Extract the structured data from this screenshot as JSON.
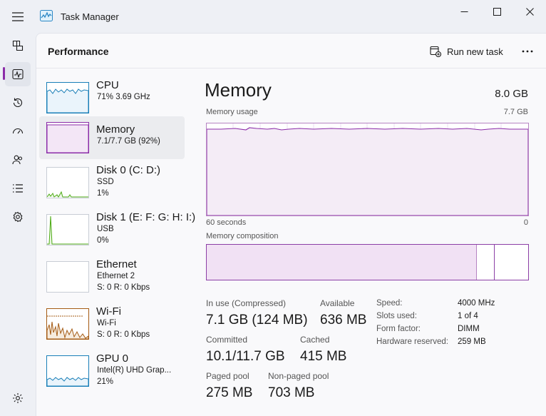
{
  "window": {
    "title": "Task Manager",
    "controls": [
      "minimize",
      "maximize",
      "close"
    ]
  },
  "nav": {
    "items": [
      {
        "name": "processes",
        "icon": "processes-icon"
      },
      {
        "name": "performance",
        "icon": "performance-icon",
        "active": true
      },
      {
        "name": "app-history",
        "icon": "history-icon"
      },
      {
        "name": "startup-apps",
        "icon": "startup-icon"
      },
      {
        "name": "users",
        "icon": "users-icon"
      },
      {
        "name": "details",
        "icon": "details-icon"
      },
      {
        "name": "services",
        "icon": "services-icon"
      },
      {
        "name": "settings",
        "icon": "gear-icon"
      }
    ]
  },
  "header": {
    "title": "Performance",
    "run_new_task": "Run new task"
  },
  "perf_list": [
    {
      "title": "CPU",
      "lines": [
        "71%  3.69 GHz"
      ],
      "color": "#1a7fb8"
    },
    {
      "title": "Memory",
      "lines": [
        "7.1/7.7 GB (92%)"
      ],
      "color": "#8b2ca8",
      "selected": true
    },
    {
      "title": "Disk 0 (C: D:)",
      "lines": [
        "SSD",
        "1%"
      ],
      "color": "#4caa14"
    },
    {
      "title": "Disk 1 (E: F: G: H: I:)",
      "lines": [
        "USB",
        "0%"
      ],
      "color": "#4caa14"
    },
    {
      "title": "Ethernet",
      "lines": [
        "Ethernet 2",
        "S: 0  R: 0 Kbps"
      ],
      "color": "#a55b14"
    },
    {
      "title": "Wi-Fi",
      "lines": [
        "Wi-Fi",
        "S: 0  R: 0 Kbps"
      ],
      "color": "#a55b14"
    },
    {
      "title": "GPU 0",
      "lines": [
        "Intel(R) UHD Grap...",
        "21%"
      ],
      "color": "#1a7fb8"
    }
  ],
  "detail": {
    "title": "Memory",
    "total": "8.0 GB",
    "usage_label": "Memory usage",
    "usage_max": "7.7 GB",
    "time_label": "60 seconds",
    "time_min": "0",
    "composition_label": "Memory composition",
    "composition": {
      "in_use_fraction": 0.92,
      "modified_fraction": 0.055,
      "standby_fraction": 0.02
    },
    "accent_color": "#8b2ca8",
    "stats": {
      "in_use_label": "In use (Compressed)",
      "in_use_value": "7.1 GB (124 MB)",
      "available_label": "Available",
      "available_value": "636 MB",
      "committed_label": "Committed",
      "committed_value": "10.1/11.7 GB",
      "cached_label": "Cached",
      "cached_value": "415 MB",
      "paged_label": "Paged pool",
      "paged_value": "275 MB",
      "nonpaged_label": "Non-paged pool",
      "nonpaged_value": "703 MB"
    },
    "specs": [
      {
        "label": "Speed:",
        "value": "4000 MHz"
      },
      {
        "label": "Slots used:",
        "value": "1 of 4"
      },
      {
        "label": "Form factor:",
        "value": "DIMM"
      },
      {
        "label": "Hardware reserved:",
        "value": "259 MB"
      }
    ]
  }
}
